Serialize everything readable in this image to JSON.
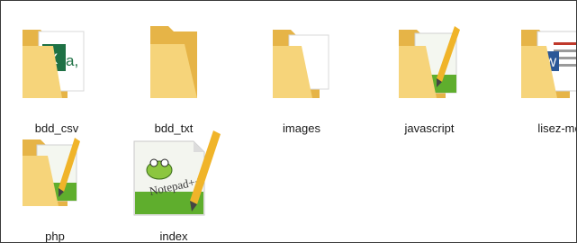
{
  "files": [
    {
      "name": "bdd_csv",
      "type": "folder",
      "preview": "excel-csv"
    },
    {
      "name": "bdd_txt",
      "type": "folder",
      "preview": "empty"
    },
    {
      "name": "images",
      "type": "folder",
      "preview": "image"
    },
    {
      "name": "javascript",
      "type": "folder",
      "preview": "notepad-plus-plus"
    },
    {
      "name": "lisez-moi",
      "type": "folder",
      "preview": "word"
    },
    {
      "name": "php",
      "type": "folder",
      "preview": "notepad-plus-plus"
    },
    {
      "name": "index",
      "type": "file",
      "preview": "notepad-plus-plus"
    }
  ],
  "colors": {
    "folder_back": "#e8b94a",
    "folder_front": "#f7d77c",
    "excel_green": "#1e7145",
    "word_blue": "#2b5797",
    "grass_green": "#5fae2d"
  }
}
